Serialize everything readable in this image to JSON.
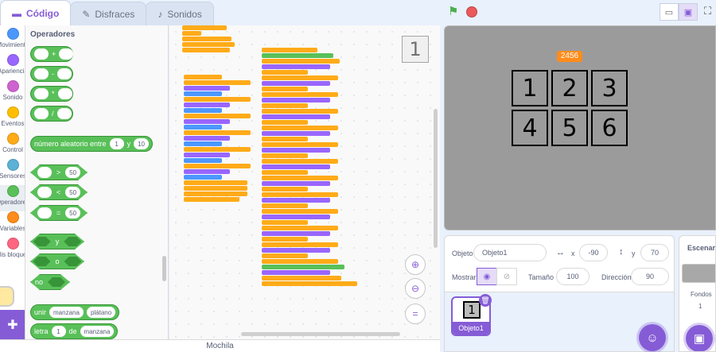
{
  "tabs": [
    {
      "label": "Código",
      "icon": "code-icon"
    },
    {
      "label": "Disfraces",
      "icon": "brush-icon"
    },
    {
      "label": "Sonidos",
      "icon": "speaker-icon"
    }
  ],
  "categories": [
    {
      "label": "Movimiento",
      "color": "#4c97ff"
    },
    {
      "label": "Apariencia",
      "color": "#9966ff"
    },
    {
      "label": "Sonido",
      "color": "#cf63cf"
    },
    {
      "label": "Eventos",
      "color": "#ffbf00"
    },
    {
      "label": "Control",
      "color": "#ffab19"
    },
    {
      "label": "Sensores",
      "color": "#5cb1d6"
    },
    {
      "label": "Operadores",
      "color": "#59c059"
    },
    {
      "label": "Variables",
      "color": "#ff8c1a"
    },
    {
      "label": "Mis bloques",
      "color": "#ff6680"
    }
  ],
  "palette": {
    "title": "Operadores",
    "arith_ops": [
      "+",
      "-",
      "*",
      "/"
    ],
    "random": {
      "label1": "número aleatorio entre",
      "from": "1",
      "label2": "y",
      "to": "10"
    },
    "compare": [
      {
        "op": ">",
        "value": "50"
      },
      {
        "op": "<",
        "value": "50"
      },
      {
        "op": "=",
        "value": "50"
      }
    ],
    "logic": [
      "y",
      "o",
      "no"
    ],
    "join": {
      "label": "unir",
      "a": "manzana",
      "b": "plátano"
    },
    "letter": {
      "label1": "letra",
      "n": "1",
      "label2": "de",
      "word": "manzana"
    }
  },
  "workspace": {
    "sprite_thumb": "1"
  },
  "backpack": {
    "label": "Mochila"
  },
  "stage": {
    "score": "2456",
    "cells": [
      "1",
      "2",
      "3",
      "4",
      "5",
      "6"
    ]
  },
  "sprite_info": {
    "object_label": "Objeto",
    "object_name": "Objeto1",
    "x_label": "x",
    "x_value": "-90",
    "y_label": "y",
    "y_value": "70",
    "show_label": "Mostrar",
    "size_label": "Tamaño",
    "size_value": "100",
    "direction_label": "Dirección",
    "direction_value": "90"
  },
  "sprites": [
    {
      "name": "Objeto1",
      "thumb": "1"
    }
  ],
  "stage_target": {
    "title": "Escenario",
    "backdrops_label": "Fondos",
    "backdrops_count": "1"
  }
}
